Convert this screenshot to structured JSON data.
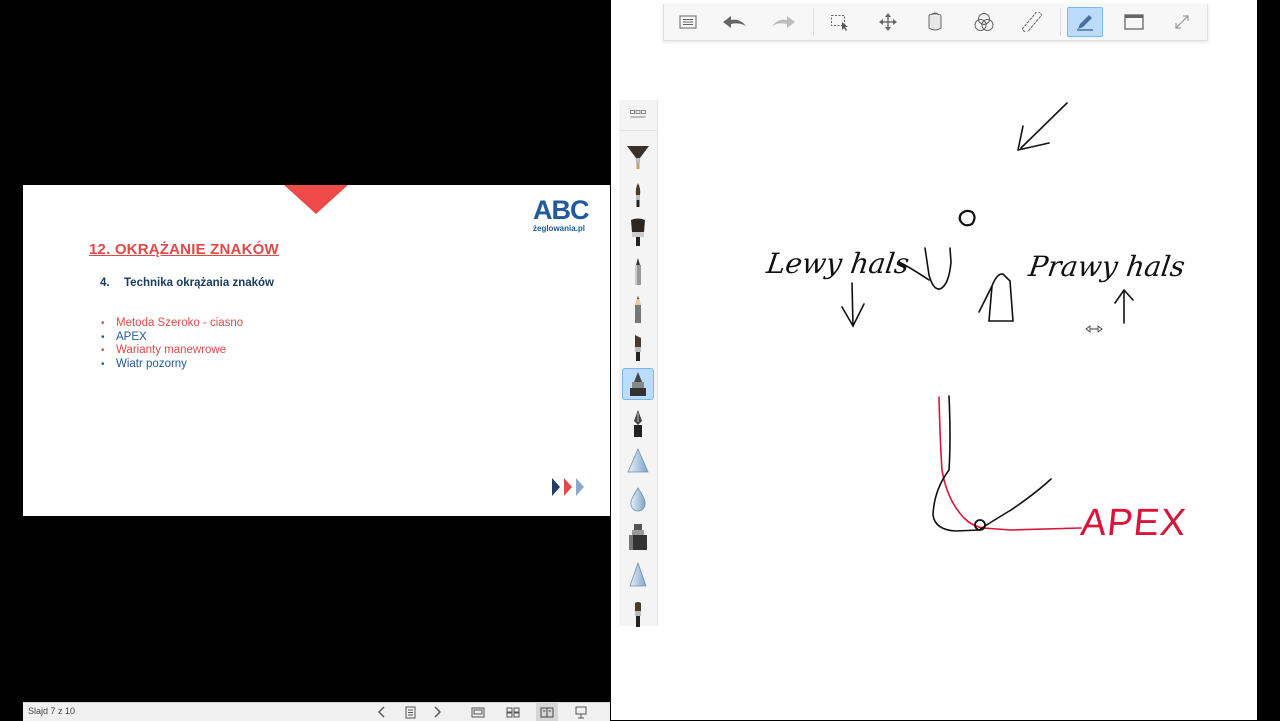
{
  "slide": {
    "title": "12. OKRĄŻANIE ZNAKÓW",
    "subtitle_num": "4.",
    "subtitle_text": "Technika okrążania znaków",
    "logo_main": "ABC",
    "logo_sub": "żeglowania.pl",
    "bullets": [
      {
        "text": "Metoda Szeroko - ciasno",
        "color": "red"
      },
      {
        "text": "APEX",
        "color": "blue"
      },
      {
        "text": "Warianty manewrowe",
        "color": "red"
      },
      {
        "text": "Wiatr pozorny",
        "color": "blue"
      }
    ],
    "accent_color": "#e14848",
    "brand_color": "#1f5a9a"
  },
  "statusbar": {
    "slide_counter": "Slajd 7 z 10",
    "buttons": [
      "prev-icon",
      "notes-icon",
      "next-icon",
      "normal-view-icon",
      "sorter-view-icon",
      "reading-view-icon",
      "slideshow-icon"
    ]
  },
  "whiteboard": {
    "toolbar_icons": [
      "list-icon",
      "undo-icon",
      "redo-icon",
      "select-icon",
      "move-icon",
      "bucket-icon",
      "color-circles-icon",
      "ruler-icon",
      "pen-icon",
      "window-icon",
      "expand-icon"
    ],
    "active_tool": "pen-icon",
    "brushes": [
      "fan-brush",
      "round-brush",
      "wide-brush",
      "marker-brush",
      "pencil-brush",
      "flat-brush",
      "felt-pen",
      "fountain-pen",
      "cone-tool",
      "drop-tool",
      "highlighter-tool",
      "cone-tool-2",
      "small-brush"
    ],
    "active_brush": "felt-pen",
    "handwriting": {
      "left_label": "Lewy hals",
      "right_label": "Prawy hals",
      "apex_label": "APEX"
    },
    "ink_colors": {
      "black": "#111111",
      "red": "#d9153a"
    }
  }
}
